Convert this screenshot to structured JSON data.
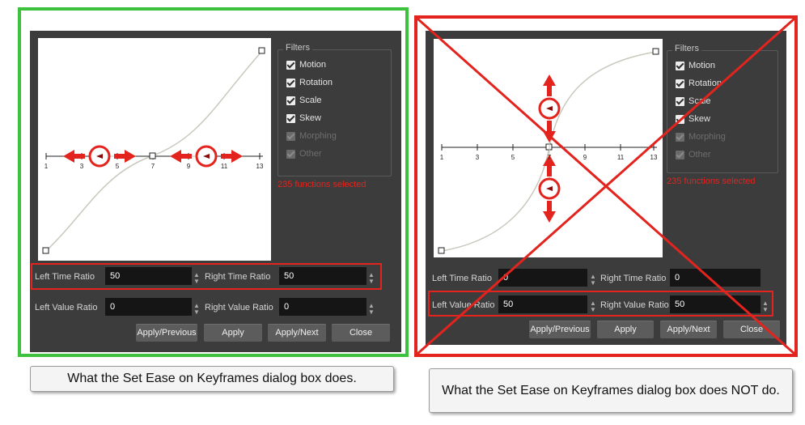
{
  "colors": {
    "good_frame": "#3cc23c",
    "bad_frame": "#e3231d",
    "dialog_bg": "#3c3c3c",
    "field_bg": "#151515",
    "warning_text": "#e3231d"
  },
  "panels": [
    {
      "filters": {
        "title": "Filters",
        "items": [
          {
            "label": "Motion",
            "enabled": true
          },
          {
            "label": "Rotation",
            "enabled": true
          },
          {
            "label": "Scale",
            "enabled": true
          },
          {
            "label": "Skew",
            "enabled": true
          },
          {
            "label": "Morphing",
            "enabled": false
          },
          {
            "label": "Other",
            "enabled": false
          }
        ]
      },
      "selected_text": "235 functions selected",
      "axis_ticks": [
        "1",
        "3",
        "5",
        "7",
        "9",
        "11",
        "13"
      ],
      "fields": {
        "left_time_label": "Left Time Ratio",
        "left_time_value": "50",
        "right_time_label": "Right Time Ratio",
        "right_time_value": "50",
        "left_value_label": "Left Value Ratio",
        "left_value_value": "0",
        "right_value_label": "Right Value Ratio",
        "right_value_value": "0"
      },
      "buttons": {
        "apply_previous": "Apply/Previous",
        "apply": "Apply",
        "apply_next": "Apply/Next",
        "close": "Close"
      },
      "caption": "What the Set Ease on Keyframes dialog box does."
    },
    {
      "filters": {
        "title": "Filters",
        "items": [
          {
            "label": "Motion",
            "enabled": true
          },
          {
            "label": "Rotation",
            "enabled": true
          },
          {
            "label": "Scale",
            "enabled": true
          },
          {
            "label": "Skew",
            "enabled": true
          },
          {
            "label": "Morphing",
            "enabled": false
          },
          {
            "label": "Other",
            "enabled": false
          }
        ]
      },
      "selected_text": "235 functions selected",
      "axis_ticks": [
        "1",
        "3",
        "5",
        "7",
        "9",
        "11",
        "13"
      ],
      "fields": {
        "left_time_label": "Left Time Ratio",
        "left_time_value": "0",
        "right_time_label": "Right Time Ratio",
        "right_time_value": "0",
        "left_value_label": "Left Value Ratio",
        "left_value_value": "50",
        "right_value_label": "Right Value Ratio",
        "right_value_value": "50"
      },
      "buttons": {
        "apply_previous": "Apply/Previous",
        "apply": "Apply",
        "apply_next": "Apply/Next",
        "close": "Close"
      },
      "caption": "What the Set Ease on Keyframes dialog box does NOT do."
    }
  ]
}
